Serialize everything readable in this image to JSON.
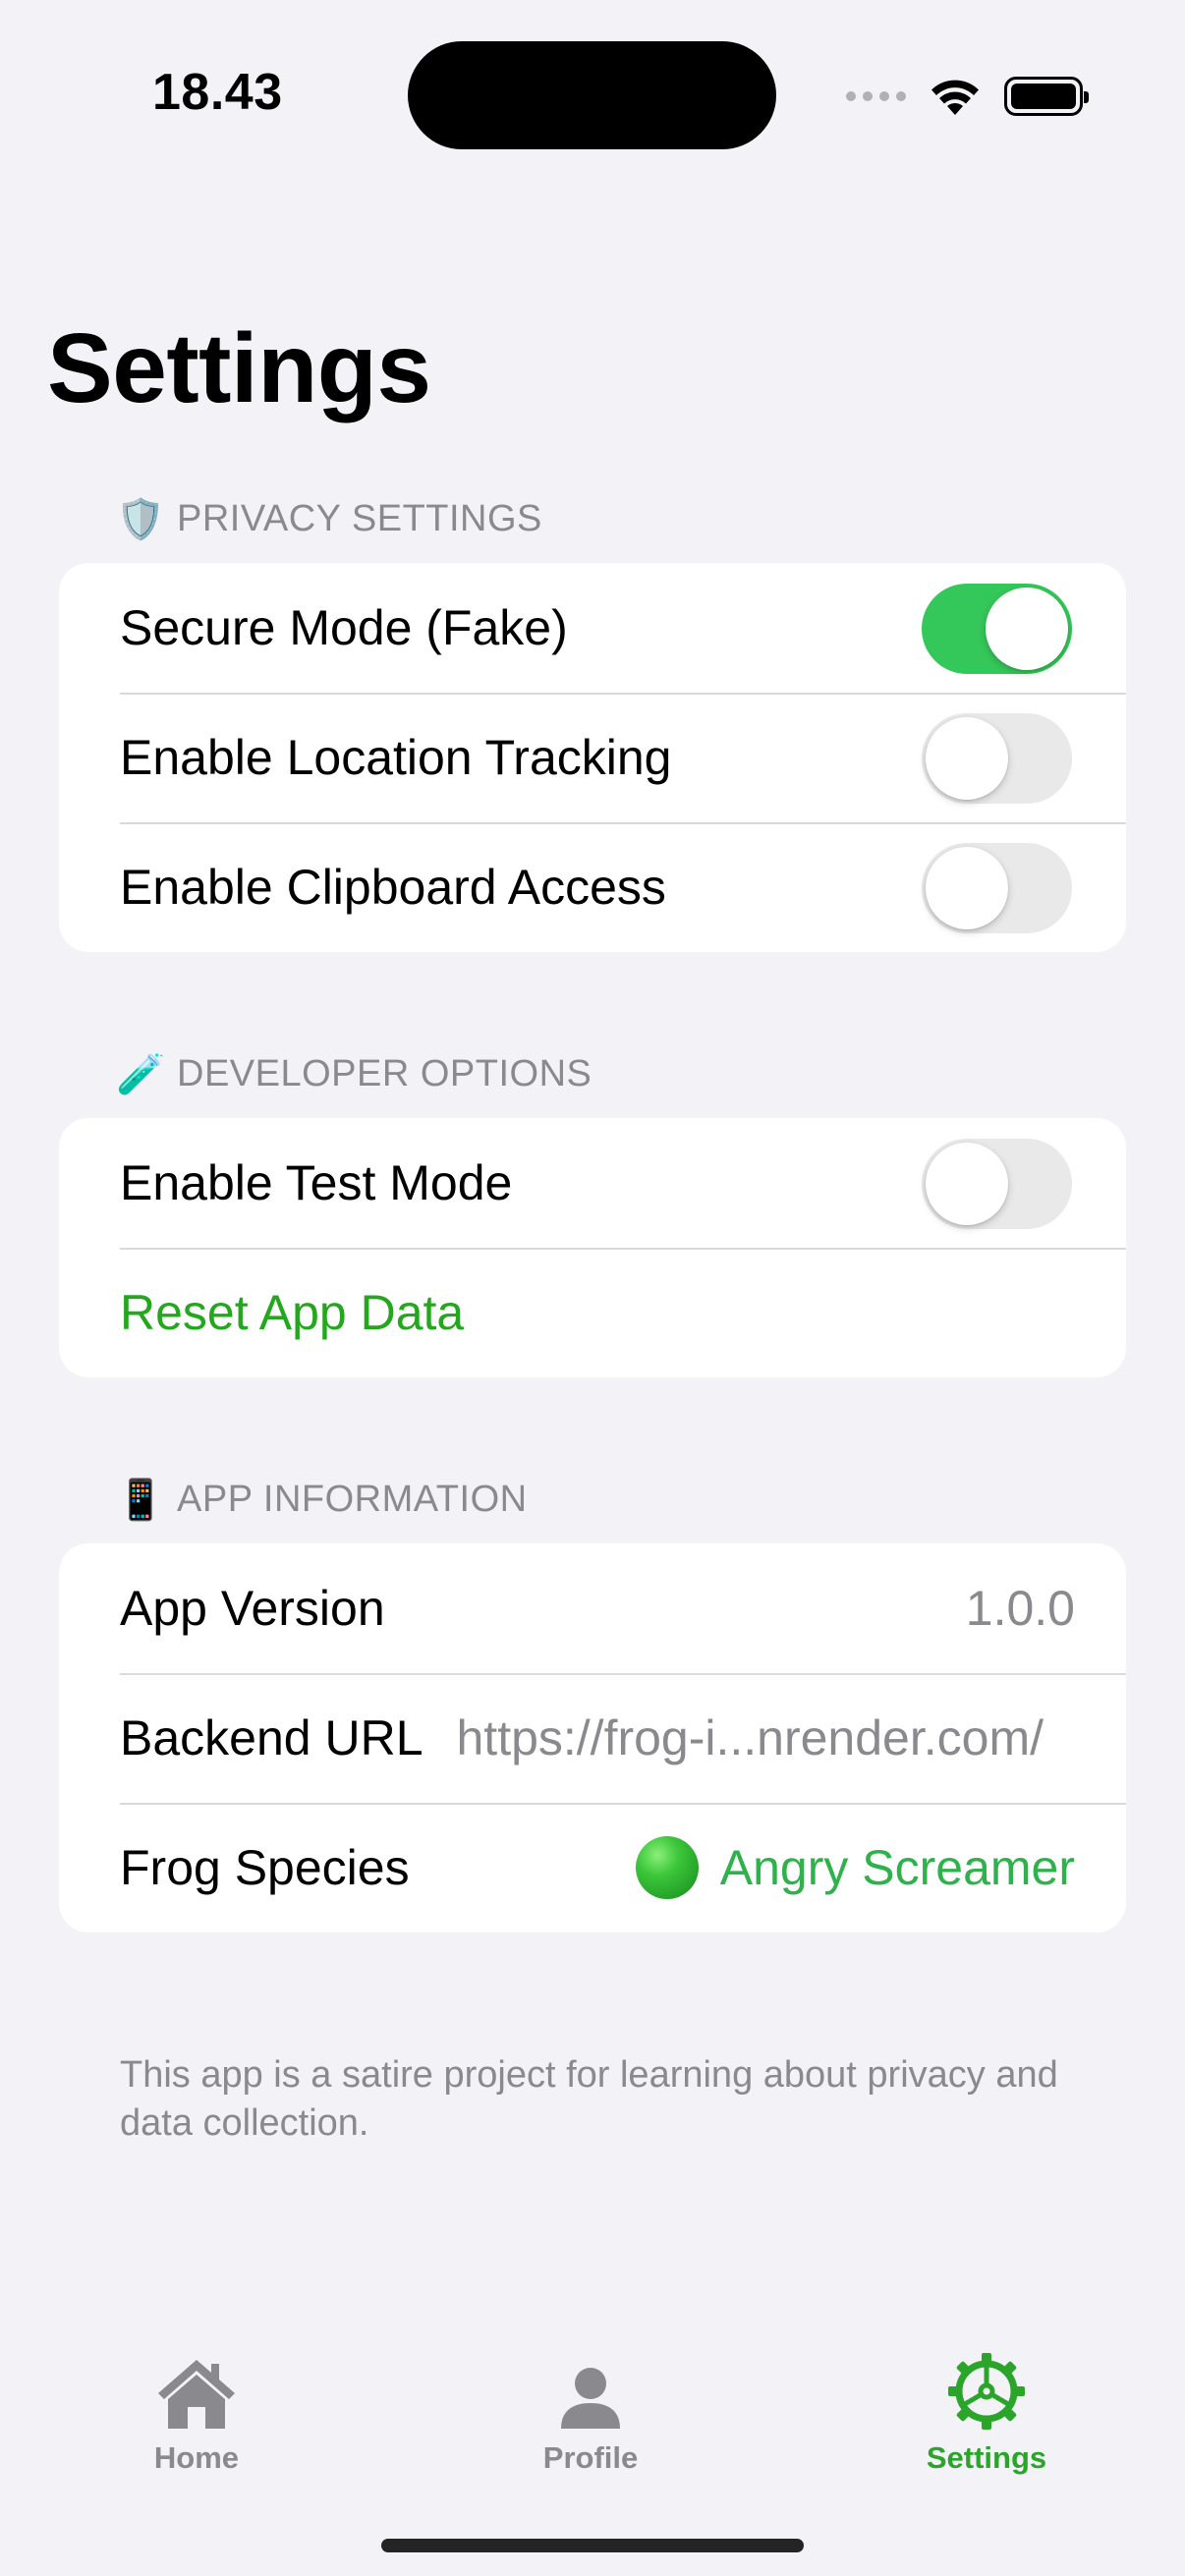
{
  "status_bar": {
    "time": "18.43"
  },
  "title": "Settings",
  "sections": {
    "privacy": {
      "emoji": "🛡️",
      "header": "PRIVACY SETTINGS",
      "rows": [
        {
          "label": "Secure Mode (Fake)",
          "on": true
        },
        {
          "label": "Enable Location Tracking",
          "on": false
        },
        {
          "label": "Enable Clipboard Access",
          "on": false
        }
      ]
    },
    "developer": {
      "emoji": "🧪",
      "header": "DEVELOPER OPTIONS",
      "test_mode_label": "Enable Test Mode",
      "test_mode_on": false,
      "reset_label": "Reset App Data"
    },
    "app_info": {
      "emoji": "📱",
      "header": "APP INFORMATION",
      "version_label": "App Version",
      "version_value": "1.0.0",
      "backend_label": "Backend URL",
      "backend_value": "https://frog-i...nrender.com/",
      "species_label": "Frog Species",
      "species_value": "Angry Screamer"
    }
  },
  "footer_note": "This app is a satire project for learning about privacy and data collection.",
  "tab_bar": {
    "home": "Home",
    "profile": "Profile",
    "settings": "Settings",
    "active": "settings"
  },
  "colors": {
    "accent": "#2aa52a",
    "toggle_on": "#34c759",
    "background": "#f2f2f7"
  }
}
